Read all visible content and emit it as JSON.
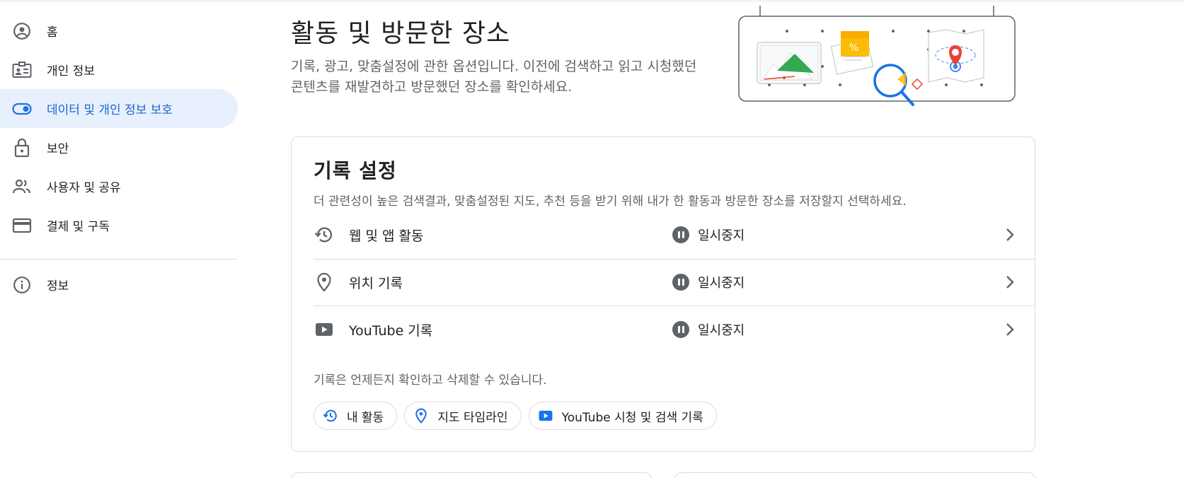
{
  "sidebar": {
    "items": [
      {
        "label": "홈",
        "icon": "account-circle-icon"
      },
      {
        "label": "개인 정보",
        "icon": "id-card-icon"
      },
      {
        "label": "데이터 및 개인 정보 보호",
        "icon": "toggle-icon",
        "active": true
      },
      {
        "label": "보안",
        "icon": "lock-icon"
      },
      {
        "label": "사용자 및 공유",
        "icon": "people-icon"
      },
      {
        "label": "결제 및 구독",
        "icon": "credit-card-icon"
      }
    ],
    "info": {
      "label": "정보",
      "icon": "info-icon"
    }
  },
  "header": {
    "title": "활동 및 방문한 장소",
    "description": "기록, 광고, 맞춤설정에 관한 옵션입니다. 이전에 검색하고 읽고 시청했던 콘텐츠를 재발견하고 방문했던 장소를 확인하세요."
  },
  "history_card": {
    "title": "기록 설정",
    "subtitle": "더 관련성이 높은 검색결과, 맞춤설정된 지도, 추천 등을 받기 위해 내가 한 활동과 방문한 장소를 저장할지 선택하세요.",
    "rows": [
      {
        "label": "웹 및 앱 활동",
        "status": "일시중지",
        "icon": "history-icon"
      },
      {
        "label": "위치 기록",
        "status": "일시중지",
        "icon": "location-pin-icon"
      },
      {
        "label": "YouTube 기록",
        "status": "일시중지",
        "icon": "youtube-icon"
      }
    ],
    "note": "기록은 언제든지 확인하고 삭제할 수 있습니다.",
    "chips": [
      {
        "label": "내 활동",
        "icon": "history-icon"
      },
      {
        "label": "지도 타임라인",
        "icon": "location-pin-icon"
      },
      {
        "label": "YouTube 시청 및 검색 기록",
        "icon": "youtube-icon"
      }
    ]
  },
  "colors": {
    "accent": "#1a73e8",
    "active_bg": "#e8f0fe",
    "active_text": "#1967d2",
    "icon_gray": "#5f6368",
    "border": "#dadce0"
  }
}
